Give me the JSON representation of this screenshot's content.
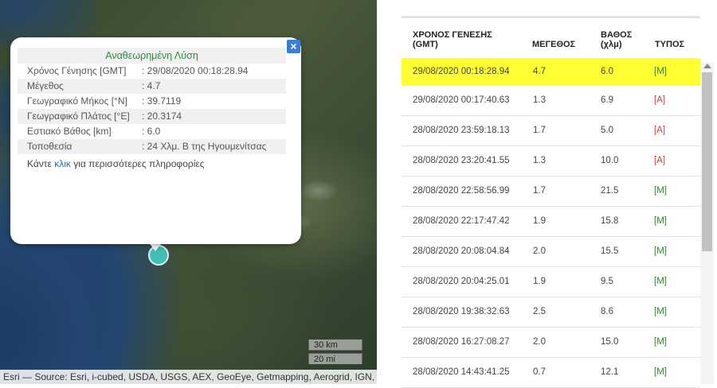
{
  "popup": {
    "title": "Αναθεωρημένη Λύση",
    "rows": [
      {
        "label": "Χρόνος Γένησης [GMT]",
        "value": ": 29/08/2020 00:18:28.94"
      },
      {
        "label": "Μέγεθος",
        "value": ": 4.7"
      },
      {
        "label": "Γεωγραφικό Μήκος [°N]",
        "value": ": 39.7119"
      },
      {
        "label": "Γεωγραφικό Πλάτος [°E]",
        "value": ": 20.3174"
      },
      {
        "label": "Εστιακό Βάθος [km]",
        "value": ": 6.0"
      },
      {
        "label": "Τοποθεσία",
        "value": ": 24 Χλμ. Β της Ηγουμενίτσας"
      }
    ],
    "more_prefix": "Κάντε ",
    "more_link": "κλικ",
    "more_suffix": " για περισσότερες πληροφορίες",
    "close_icon": "close-icon"
  },
  "map": {
    "scale_km": "30 km",
    "scale_mi": "20 mi",
    "attribution": "Esri — Source: Esri, i-cubed, USDA, USGS, AEX, GeoEye, Getmapping, Aerogrid, IGN,"
  },
  "table": {
    "headers": {
      "time": "ΧΡΟΝΟΣ ΓΕΝΕΣΗΣ (GMT)",
      "magnitude": "ΜΕΓΕΘΟΣ",
      "depth": "ΒΑΘΟΣ (χλμ)",
      "type": "ΤΥΠΟΣ"
    },
    "rows": [
      {
        "time": "29/08/2020 00:18:28.94",
        "magnitude": "4.7",
        "depth": "6.0",
        "type": "[M]"
      },
      {
        "time": "29/08/2020 00:17:40.63",
        "magnitude": "1.3",
        "depth": "6.9",
        "type": "[A]"
      },
      {
        "time": "28/08/2020 23:59:18.13",
        "magnitude": "1.7",
        "depth": "5.0",
        "type": "[A]"
      },
      {
        "time": "28/08/2020 23:20:41.55",
        "magnitude": "1.3",
        "depth": "10.0",
        "type": "[A]"
      },
      {
        "time": "28/08/2020 22:58:56.99",
        "magnitude": "1.7",
        "depth": "21.5",
        "type": "[M]"
      },
      {
        "time": "28/08/2020 22:17:47.42",
        "magnitude": "1.9",
        "depth": "15.8",
        "type": "[M]"
      },
      {
        "time": "28/08/2020 20:08:04.84",
        "magnitude": "2.0",
        "depth": "15.5",
        "type": "[M]"
      },
      {
        "time": "28/08/2020 20:04:25.01",
        "magnitude": "1.9",
        "depth": "9.5",
        "type": "[M]"
      },
      {
        "time": "28/08/2020 19:38:32.63",
        "magnitude": "2.5",
        "depth": "8.6",
        "type": "[M]"
      },
      {
        "time": "28/08/2020 16:27:08.27",
        "magnitude": "2.0",
        "depth": "15.0",
        "type": "[M]"
      },
      {
        "time": "28/08/2020 14:43:41.25",
        "magnitude": "0.7",
        "depth": "12.1",
        "type": "[M]"
      }
    ],
    "selected_index": 0,
    "highlight_color": "#ffff33",
    "type_colors": {
      "M": "#2e8b2e",
      "A": "#d23c3c"
    }
  }
}
